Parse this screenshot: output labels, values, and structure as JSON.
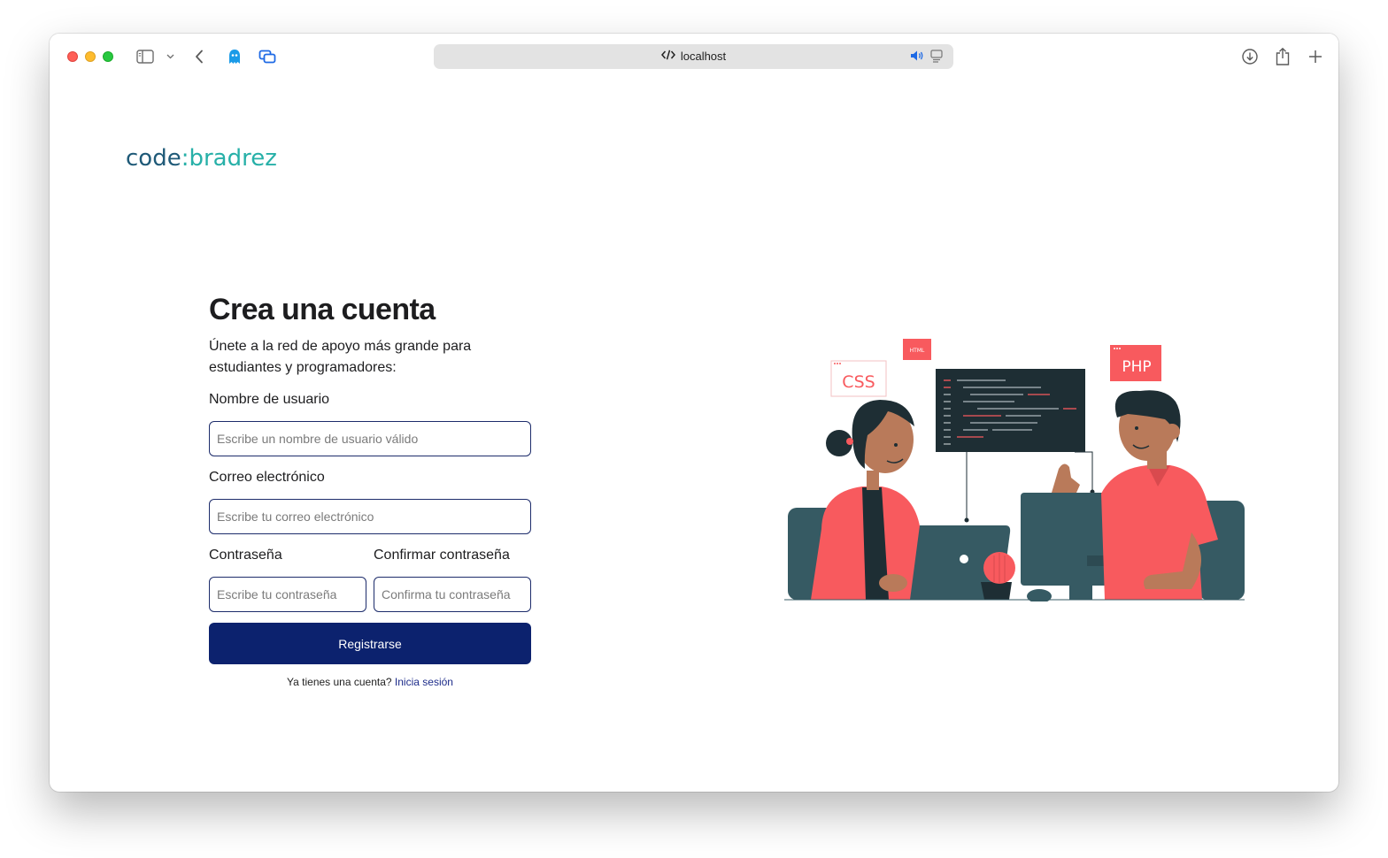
{
  "browser": {
    "url": "localhost",
    "icons": [
      "sidebar-icon",
      "chevron-down-icon",
      "back-icon",
      "ghost-extension-icon",
      "tabs-overview-icon",
      "code-icon",
      "speaker-icon",
      "reader-icon",
      "download-icon",
      "share-icon",
      "new-tab-icon"
    ]
  },
  "logo": {
    "part1": "code",
    "sep": ":",
    "part2": "bradrez"
  },
  "form": {
    "title": "Crea una cuenta",
    "subtitle": "Únete a la red de apoyo más grande para estudiantes y programadores:",
    "username": {
      "label": "Nombre de usuario",
      "placeholder": "Escribe un nombre de usuario válido"
    },
    "email": {
      "label": "Correo electrónico",
      "placeholder": "Escribe tu correo electrónico"
    },
    "password": {
      "label": "Contraseña",
      "placeholder": "Escribe tu contraseña"
    },
    "confirm": {
      "label": "Confirmar contraseña",
      "placeholder": "Confirma tu contraseña"
    },
    "submit": "Registrarse",
    "has_account": "Ya tienes una cuenta?",
    "login_link": "Inicia sesión"
  },
  "illustration": {
    "tag_css": "CSS",
    "tag_html": "HTML",
    "tag_php": "PHP"
  },
  "colors": {
    "brand_dark": "#0c226e",
    "accent": "#f85a5e",
    "teal": "#27b0a8",
    "slate": "#365a63"
  }
}
